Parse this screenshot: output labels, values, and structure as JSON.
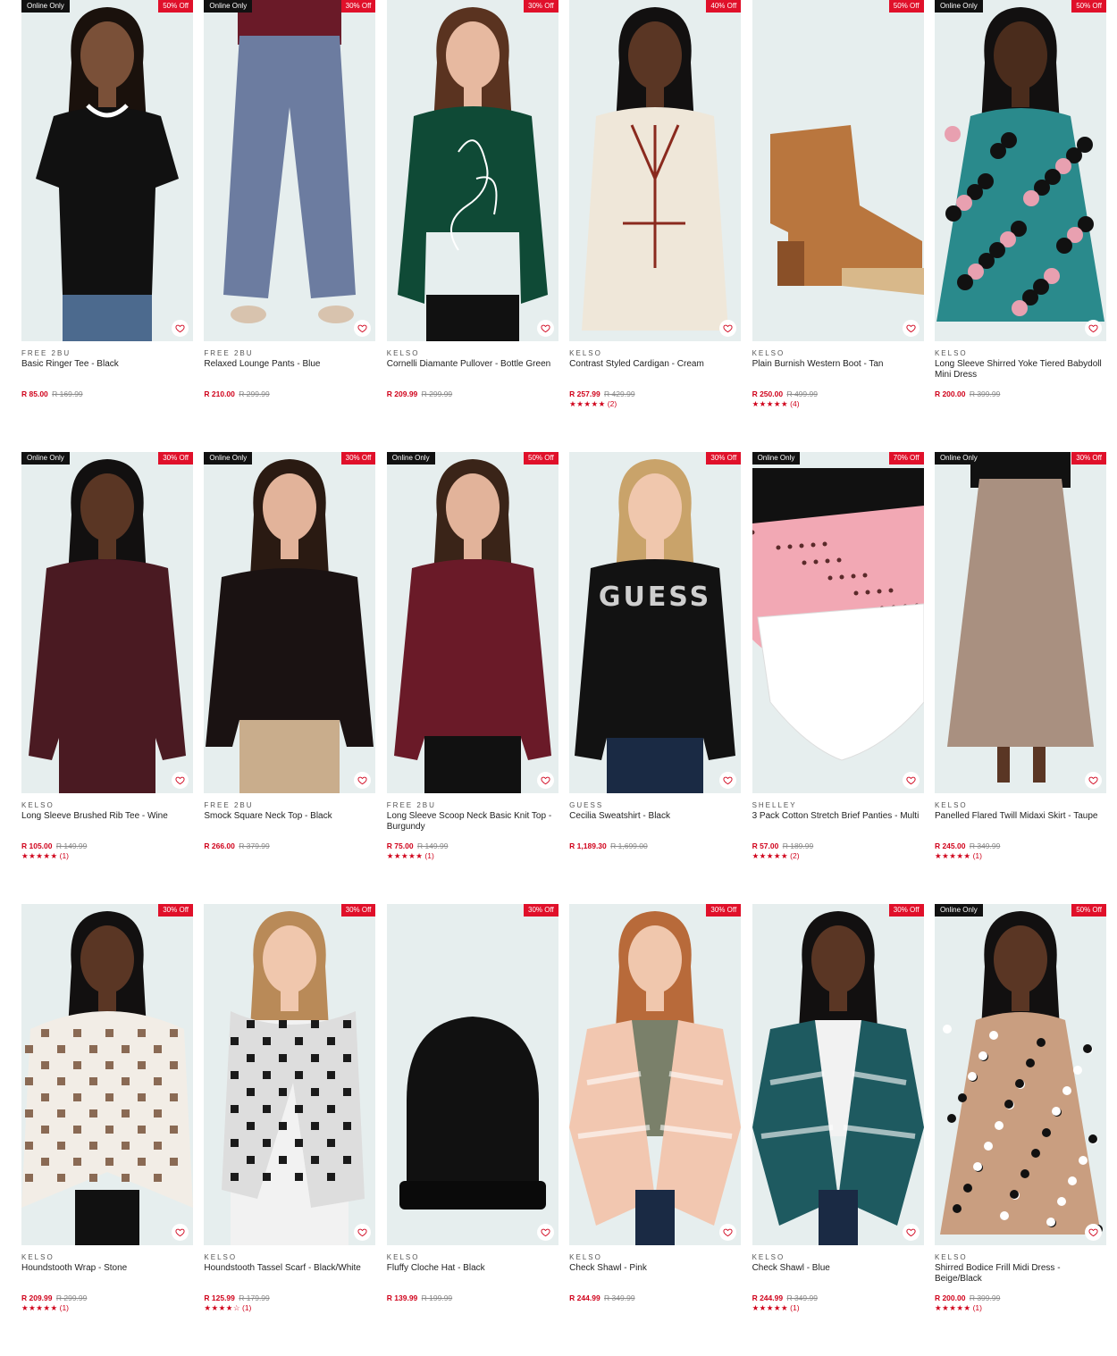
{
  "products": [
    {
      "online": "Online Only",
      "discount": "50% Off",
      "brand": "FREE 2BU",
      "name": "Basic Ringer Tee - Black",
      "price": "R 85.00",
      "was": "R 169.99",
      "stars": "",
      "count": "",
      "img": "tee",
      "bg": "#e6eeee",
      "main": "#111111",
      "skin": "#7a5038",
      "hair": "#1a110c"
    },
    {
      "online": "Online Only",
      "discount": "30% Off",
      "brand": "FREE 2BU",
      "name": "Relaxed Lounge Pants - Blue",
      "price": "R 210.00",
      "was": "R 299.99",
      "stars": "",
      "count": "",
      "img": "pants",
      "bg": "#e6eeee",
      "main": "#6c7ca0",
      "skin": "#cfa58a",
      "hair": "#2a1a12"
    },
    {
      "online": "",
      "discount": "30% Off",
      "brand": "KELSO",
      "name": "Cornelli Diamante Pullover - Bottle Green",
      "price": "R 209.99",
      "was": "R 299.99",
      "stars": "",
      "count": "",
      "img": "sweater-print",
      "bg": "#e6eeee",
      "main": "#0f4a36",
      "skin": "#e7b9a0",
      "hair": "#5a3320"
    },
    {
      "online": "",
      "discount": "40% Off",
      "brand": "KELSO",
      "name": "Contrast Styled Cardigan - Cream",
      "price": "R 257.99",
      "was": "R 429.99",
      "stars": "★★★★★",
      "count": "(2)",
      "img": "cardigan",
      "bg": "#e6eeee",
      "main": "#efe7d9",
      "skin": "#5a3624",
      "hair": "#121010"
    },
    {
      "online": "",
      "discount": "50% Off",
      "brand": "KELSO",
      "name": "Plain Burnish Western Boot - Tan",
      "price": "R 250.00",
      "was": "R 499.99",
      "stars": "★★★★★",
      "count": "(4)",
      "img": "boot",
      "bg": "#e6eeee",
      "main": "#b9763e",
      "skin": "",
      "hair": ""
    },
    {
      "online": "Online Only",
      "discount": "50% Off",
      "brand": "KELSO",
      "name": "Long Sleeve Shirred Yoke Tiered Babydoll Mini Dress",
      "price": "R 200.00",
      "was": "R 399.99",
      "stars": "",
      "count": "",
      "img": "dress-print",
      "bg": "#e6eeee",
      "main": "#2a8a8c",
      "skin": "#4a2c1c",
      "hair": "#121010"
    },
    {
      "online": "Online Only",
      "discount": "30% Off",
      "brand": "KELSO",
      "name": "Long Sleeve Brushed Rib Tee - Wine",
      "price": "R 105.00",
      "was": "R 149.99",
      "stars": "★★★★★",
      "count": "(1)",
      "img": "longtee",
      "bg": "#e6eeee",
      "main": "#4a1a22",
      "skin": "#5a3624",
      "hair": "#121010"
    },
    {
      "online": "Online Only",
      "discount": "30% Off",
      "brand": "FREE 2BU",
      "name": "Smock Square Neck Top - Black",
      "price": "R 266.00",
      "was": "R 379.99",
      "stars": "",
      "count": "",
      "img": "smock",
      "bg": "#e6eeee",
      "main": "#1a1212",
      "skin": "#e2b39a",
      "hair": "#2a1a12"
    },
    {
      "online": "Online Only",
      "discount": "50% Off",
      "brand": "FREE 2BU",
      "name": "Long Sleeve Scoop Neck Basic Knit Top - Burgundy",
      "price": "R 75.00",
      "was": "R 149.99",
      "stars": "★★★★★",
      "count": "(1)",
      "img": "longtee",
      "bg": "#e6eeee",
      "main": "#6a1a28",
      "skin": "#e2b39a",
      "hair": "#3a2418"
    },
    {
      "online": "",
      "discount": "30% Off",
      "brand": "GUESS",
      "name": "Cecilia Sweatshirt - Black",
      "price": "R 1,189.30",
      "was": "R 1,699.00",
      "stars": "",
      "count": "",
      "img": "guess",
      "bg": "#e6eeee",
      "main": "#121212",
      "skin": "#f0c7ad",
      "hair": "#c9a36a"
    },
    {
      "online": "Online Only",
      "discount": "70% Off",
      "brand": "SHELLEY",
      "name": "3 Pack Cotton Stretch Brief Panties - Multi",
      "price": "R 57.00",
      "was": "R 189.99",
      "stars": "★★★★★",
      "count": "(2)",
      "img": "briefs",
      "bg": "#e6eeee",
      "main": "#f2a8b4",
      "skin": "",
      "hair": ""
    },
    {
      "online": "Online Only",
      "discount": "30% Off",
      "brand": "KELSO",
      "name": "Panelled Flared Twill Midaxi Skirt - Taupe",
      "price": "R 245.00",
      "was": "R 349.99",
      "stars": "★★★★★",
      "count": "(1)",
      "img": "skirt",
      "bg": "#e6eeee",
      "main": "#a99080",
      "skin": "#5a3624",
      "hair": ""
    },
    {
      "online": "",
      "discount": "30% Off",
      "brand": "KELSO",
      "name": "Houndstooth Wrap - Stone",
      "price": "R 209.99",
      "was": "R 299.99",
      "stars": "★★★★★",
      "count": "(1)",
      "img": "wrap",
      "bg": "#e6eeee",
      "main": "#8a6a54",
      "skin": "#5a3624",
      "hair": "#121010"
    },
    {
      "online": "",
      "discount": "30% Off",
      "brand": "KELSO",
      "name": "Houndstooth Tassel Scarf - Black/White",
      "price": "R 125.99",
      "was": "R 179.99",
      "stars": "★★★★☆",
      "count": "(1)",
      "img": "scarf",
      "bg": "#e6eeee",
      "main": "#1a1a1a",
      "skin": "#f0c7ad",
      "hair": "#b98a58"
    },
    {
      "online": "",
      "discount": "30% Off",
      "brand": "KELSO",
      "name": "Fluffy Cloche Hat - Black",
      "price": "R 139.99",
      "was": "R 199.99",
      "stars": "",
      "count": "",
      "img": "hat",
      "bg": "#e6eeee",
      "main": "#111111",
      "skin": "",
      "hair": ""
    },
    {
      "online": "",
      "discount": "30% Off",
      "brand": "KELSO",
      "name": "Check Shawl - Pink",
      "price": "R 244.99",
      "was": "R 349.99",
      "stars": "",
      "count": "",
      "img": "shawl",
      "bg": "#e6eeee",
      "main": "#f2c7b0",
      "skin": "#f0c7ad",
      "hair": "#b86a3a"
    },
    {
      "online": "",
      "discount": "30% Off",
      "brand": "KELSO",
      "name": "Check Shawl - Blue",
      "price": "R 244.99",
      "was": "R 349.99",
      "stars": "★★★★★",
      "count": "(1)",
      "img": "shawl",
      "bg": "#e6eeee",
      "main": "#1e5a60",
      "skin": "#5a3624",
      "hair": "#121010"
    },
    {
      "online": "Online Only",
      "discount": "50% Off",
      "brand": "KELSO",
      "name": "Shirred Bodice Frill Midi Dress - Beige/Black",
      "price": "R 200.00",
      "was": "R 399.99",
      "stars": "★★★★★",
      "count": "(1)",
      "img": "dress-dots",
      "bg": "#e6eeee",
      "main": "#c99e80",
      "skin": "#5a3624",
      "hair": "#121010"
    }
  ],
  "icons": {
    "wishlist": "heart-icon"
  },
  "colors": {
    "accent": "#d0021b",
    "online_badge": "#111111"
  }
}
